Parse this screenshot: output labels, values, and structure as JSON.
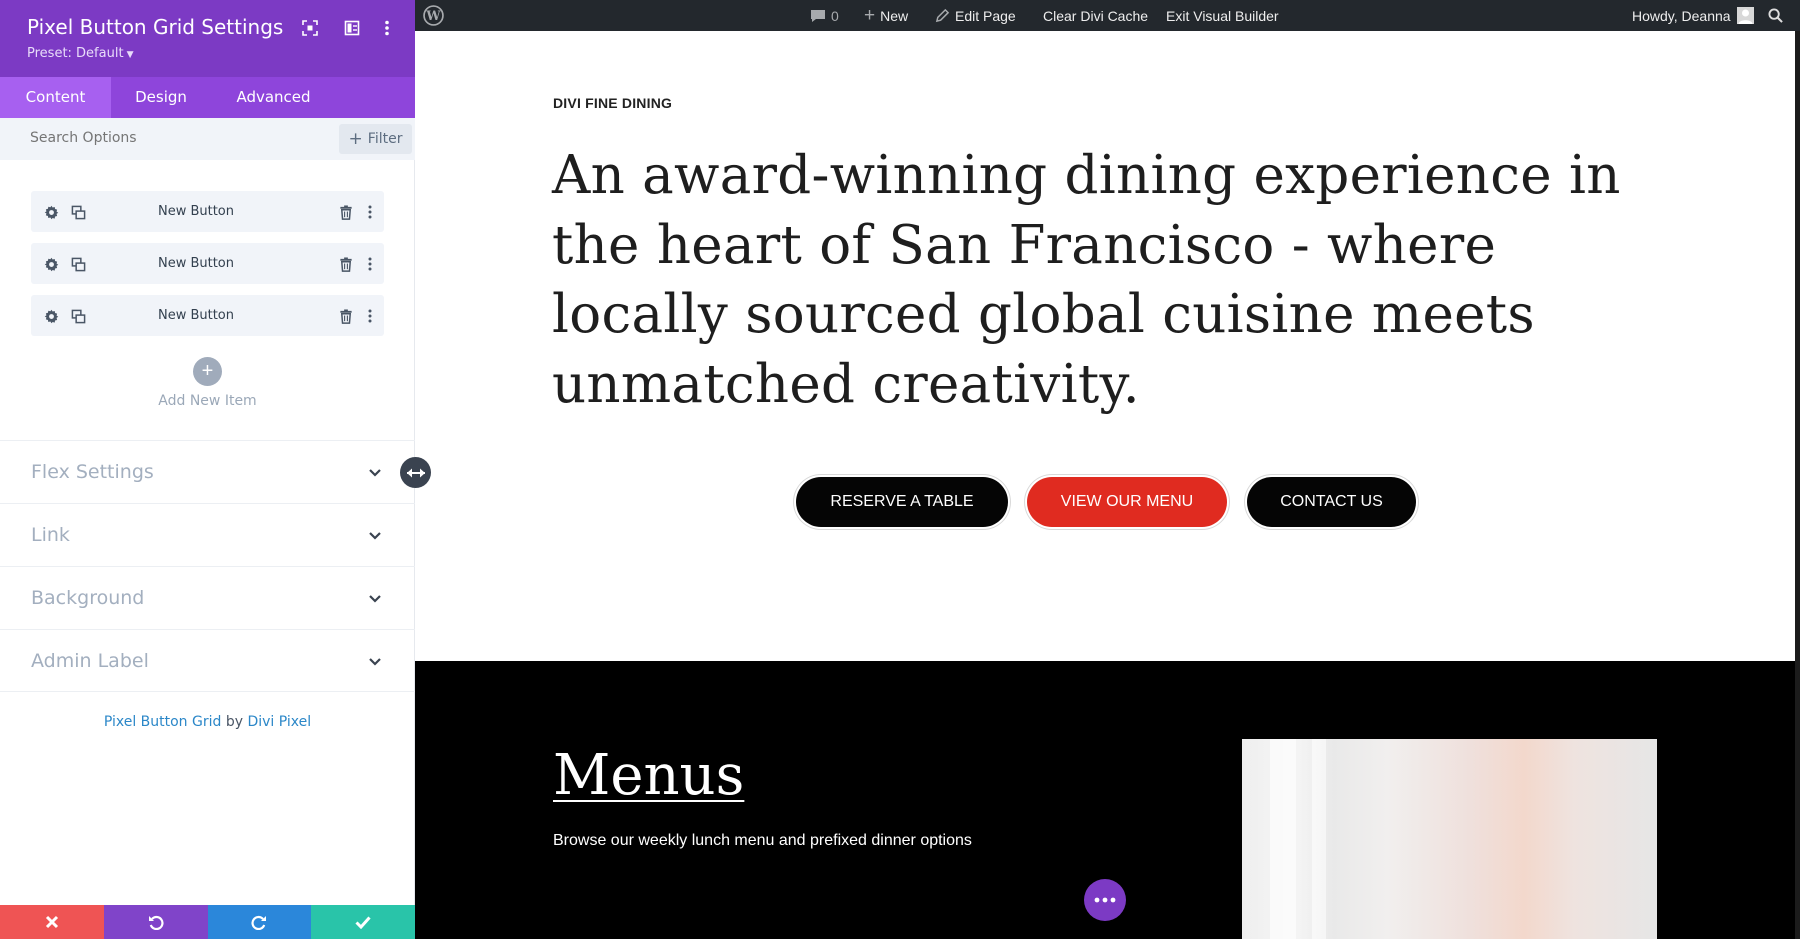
{
  "panel": {
    "title": "Pixel Button Grid Settings",
    "preset": "Preset: Default",
    "tabs": [
      {
        "label": "Content",
        "active": true
      },
      {
        "label": "Design",
        "active": false
      },
      {
        "label": "Advanced",
        "active": false
      }
    ],
    "search": {
      "placeholder": "Search Options",
      "filter_label": "Filter"
    },
    "items": [
      {
        "label": "New Button"
      },
      {
        "label": "New Button"
      },
      {
        "label": "New Button"
      }
    ],
    "add_item_label": "Add New Item",
    "sections": [
      {
        "title": "Flex Settings"
      },
      {
        "title": "Link"
      },
      {
        "title": "Background"
      },
      {
        "title": "Admin Label"
      }
    ],
    "credit": {
      "module": "Pixel Button Grid",
      "by": "by",
      "author": "Divi Pixel"
    },
    "footer_icons": [
      "close-icon",
      "undo-icon",
      "redo-icon",
      "check-icon"
    ]
  },
  "adminbar": {
    "comments_count": "0",
    "new_label": "New",
    "edit_label": "Edit Page",
    "clear_cache_label": "Clear Divi Cache",
    "exit_label": "Exit Visual Builder",
    "howdy": "Howdy, Deanna"
  },
  "hero": {
    "eyebrow": "DIVI FINE DINING",
    "headline": "An award-winning dining experience in the heart of San Francisco - where locally sourced global cuisine meets unmatched creativity.",
    "buttons": [
      {
        "label": "RESERVE A TABLE",
        "color": "#050505"
      },
      {
        "label": "VIEW OUR MENU",
        "color": "#e02b20"
      },
      {
        "label": "CONTACT US",
        "color": "#050505"
      }
    ]
  },
  "menus": {
    "title": "Menus",
    "description": "Browse our weekly lunch menu and prefixed dinner options"
  },
  "colors": {
    "panel_header": "#7c3ac4",
    "tabs_bar": "#8e45db",
    "active_tab": "#a760f0",
    "discard": "#ef5454",
    "undo": "#8044c9",
    "redo": "#2b87da",
    "save": "#29c4a9"
  }
}
